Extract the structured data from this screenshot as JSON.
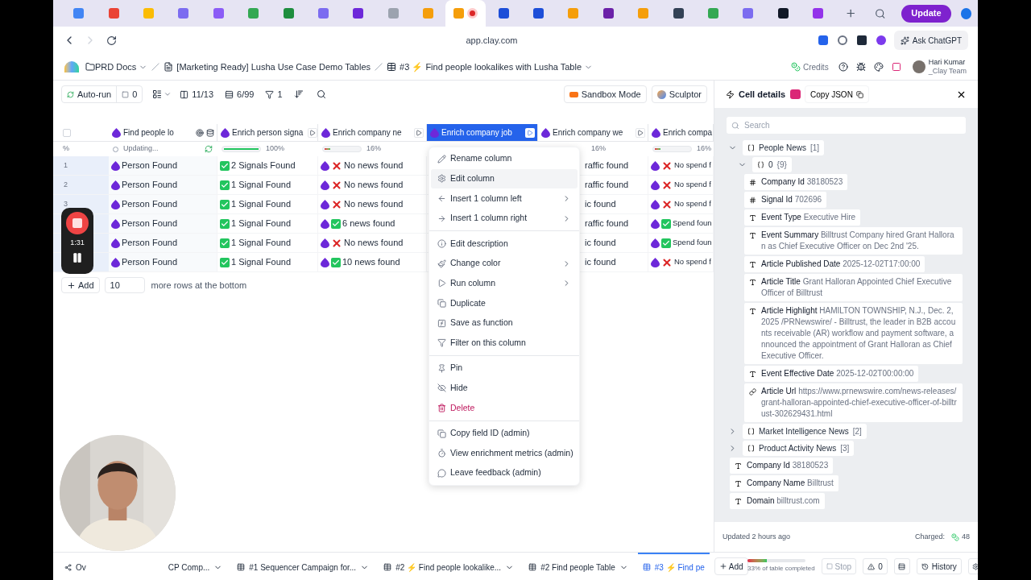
{
  "browser": {
    "tabs": [
      {
        "color": "#4285f4",
        "selected": false
      },
      {
        "color": "#ea4335",
        "selected": false
      },
      {
        "color": "#fbbc04",
        "selected": false
      },
      {
        "color": "#7c6cf0",
        "selected": false
      },
      {
        "color": "#8b5cf6",
        "selected": false
      },
      {
        "color": "#34a853",
        "selected": false
      },
      {
        "color": "#1e8e3e",
        "selected": false
      },
      {
        "color": "#7c6cf0",
        "selected": false
      },
      {
        "color": "#6d28d9",
        "selected": false
      },
      {
        "color": "#9ca3af",
        "selected": false
      },
      {
        "color": "#f59e0b",
        "selected": false
      },
      {
        "color": "#f59e0b",
        "selected": true
      },
      {
        "color": "#1d4ed8",
        "selected": false
      },
      {
        "color": "#1d4ed8",
        "selected": false
      },
      {
        "color": "#f59e0b",
        "selected": false
      },
      {
        "color": "#6b21a8",
        "selected": false
      },
      {
        "color": "#f59e0b",
        "selected": false
      },
      {
        "color": "#334155",
        "selected": false
      },
      {
        "color": "#34a853",
        "selected": false
      },
      {
        "color": "#7c6cf0",
        "selected": false
      },
      {
        "color": "#111827",
        "selected": false
      },
      {
        "color": "#9333ea",
        "selected": false
      }
    ],
    "update_button": "Update",
    "url": "app.clay.com",
    "ask_button": "Ask ChatGPT"
  },
  "breadcrumb": {
    "items": [
      "PRD Docs",
      "[Marketing Ready] Lusha Use Case Demo Tables",
      "#3 ⚡ Find people lookalikes with Lusha Table"
    ],
    "credits": "Credits",
    "user_name": "Hari Kumar",
    "user_team": "_Clay Team"
  },
  "toolbar": {
    "autorun": "Auto-run",
    "selected_count": "0",
    "columns": "11/13",
    "rows": "6/99",
    "filters": "1",
    "sandbox": "Sandbox Mode",
    "sculptor": "Sculptor"
  },
  "table": {
    "select_all_checked": false,
    "percent_label": "%",
    "row_numbers": [
      "1",
      "2",
      "3"
    ],
    "columns": [
      {
        "header": "Find people lo",
        "selected": false,
        "kind": "config",
        "progress": {
          "kind": "updating",
          "text": "Updating..."
        },
        "cells": [
          {
            "text": "Person Found"
          },
          {
            "text": "Person Found"
          },
          {
            "text": "Person Found"
          },
          {
            "text": "Person Found"
          },
          {
            "text": "Person Found"
          },
          {
            "text": "Person Found"
          }
        ]
      },
      {
        "header": "Enrich person signa",
        "selected": false,
        "kind": "run",
        "progress": {
          "kind": "bar",
          "level": 1,
          "reading": "100%"
        },
        "cells": [
          {
            "kind": "found",
            "text": "2 Signals Found"
          },
          {
            "kind": "found",
            "text": "1 Signal Found"
          },
          {
            "kind": "found",
            "text": "1 Signal Found"
          },
          {
            "kind": "found",
            "text": "1 Signal Found"
          },
          {
            "kind": "found",
            "text": "1 Signal Found"
          },
          {
            "kind": "found",
            "text": "1 Signal Found"
          }
        ]
      },
      {
        "header": "Enrich company ne",
        "selected": false,
        "kind": "run",
        "progress": {
          "kind": "bar",
          "level": 0.16,
          "reading": "16%"
        },
        "cells": [
          {
            "kind": "missing",
            "text": "No news found"
          },
          {
            "kind": "missing",
            "text": "No news found"
          },
          {
            "kind": "missing",
            "text": "No news found"
          },
          {
            "kind": "found",
            "text": "6 news found"
          },
          {
            "kind": "missing",
            "text": "No news found"
          },
          {
            "kind": "found",
            "text": "10 news found"
          }
        ]
      },
      {
        "header": "Enrich company job",
        "selected": true,
        "kind": "run"
      },
      {
        "header": "Enrich company we",
        "selected": false,
        "kind": "run",
        "partly_covered": true,
        "progress": {
          "kind": "reading",
          "reading": "16%"
        },
        "cells": [
          {
            "text": "raffic found"
          },
          {
            "text": "raffic found"
          },
          {
            "text": "ic found"
          },
          {
            "text": "raffic found"
          },
          {
            "text": "ic found"
          },
          {
            "text": "ic found"
          }
        ]
      },
      {
        "header": "Enrich compa",
        "selected": false,
        "kind": "plain",
        "progress": {
          "kind": "bar",
          "level": 0.16,
          "reading": "16%"
        },
        "cells": [
          {
            "kind": "missing",
            "text": "No spend f"
          },
          {
            "kind": "missing",
            "text": "No spend f"
          },
          {
            "kind": "missing",
            "text": "No spend f"
          },
          {
            "kind": "found",
            "text": "Spend foun"
          },
          {
            "kind": "found",
            "text": "Spend foun"
          },
          {
            "kind": "missing",
            "text": "No spend f"
          }
        ]
      }
    ]
  },
  "add_rows": {
    "button": "Add",
    "count": "10",
    "suffix": "more rows at the bottom"
  },
  "context_menu": {
    "items": [
      {
        "kind": "item",
        "label": "Rename column",
        "hovered": false
      },
      {
        "kind": "item",
        "label": "Edit column",
        "hovered": true
      },
      {
        "kind": "item",
        "label": "Insert 1 column left",
        "hovered": false,
        "submenu": true
      },
      {
        "kind": "item",
        "label": "Insert 1 column right",
        "hovered": false,
        "submenu": true
      },
      {
        "kind": "separator"
      },
      {
        "kind": "item",
        "label": "Edit description",
        "hovered": false
      },
      {
        "kind": "item",
        "label": "Change color",
        "hovered": false,
        "submenu": true
      },
      {
        "kind": "item",
        "label": "Run column",
        "hovered": false,
        "submenu": true
      },
      {
        "kind": "item",
        "label": "Duplicate",
        "hovered": false
      },
      {
        "kind": "item",
        "label": "Save as function",
        "hovered": false
      },
      {
        "kind": "item",
        "label": "Filter on this column",
        "hovered": false
      },
      {
        "kind": "separator"
      },
      {
        "kind": "item",
        "label": "Pin",
        "hovered": false
      },
      {
        "kind": "item",
        "label": "Hide",
        "hovered": false
      },
      {
        "kind": "danger",
        "label": "Delete",
        "hovered": false
      },
      {
        "kind": "separator"
      },
      {
        "kind": "item",
        "label": "Copy field ID (admin)",
        "hovered": false
      },
      {
        "kind": "item",
        "label": "View enrichment metrics (admin)",
        "hovered": false
      },
      {
        "kind": "item",
        "label": "Leave feedback (admin)",
        "hovered": false
      }
    ]
  },
  "recording": {
    "time": "1:31"
  },
  "cell_details": {
    "title": "Cell details",
    "copy_button": "Copy JSON",
    "search_placeholder": "Search",
    "tree": [
      {
        "kind": "array",
        "key": "People News",
        "count": "[1]",
        "expanded": true,
        "children": [
          {
            "kind": "object",
            "key": "0",
            "count": "{9}",
            "expanded": true,
            "children": [
              {
                "kind": "number",
                "key": "Company Id",
                "value": "38180523"
              },
              {
                "kind": "number",
                "key": "Signal Id",
                "value": "702696"
              },
              {
                "kind": "text",
                "key": "Event Type",
                "value": "Executive Hire"
              },
              {
                "kind": "text",
                "key": "Event Summary",
                "value": "Billtrust Company hired Grant Halloran as Chief Executive Officer on Dec 2nd '25."
              },
              {
                "kind": "text",
                "key": "Article Published Date",
                "value": "2025-12-02T17:00:00"
              },
              {
                "kind": "text",
                "key": "Article Title",
                "value": "Grant Halloran Appointed Chief Executive Officer of Billtrust"
              },
              {
                "kind": "text",
                "key": "Article Highlight",
                "value": "HAMILTON TOWNSHIP, N.J., Dec. 2, 2025 /PRNewswire/ - Billtrust, the leader in B2B accounts receivable (AR) workflow and payment software, announced the appointment of Grant Halloran as Chief Executive Officer."
              },
              {
                "kind": "text",
                "key": "Event Effective Date",
                "value": "2025-12-02T00:00:00"
              },
              {
                "kind": "link",
                "key": "Article Url",
                "value": "https://www.prnewswire.com/news-releases/grant-halloran-appointed-chief-executive-officer-of-billtrust-302629431.html"
              }
            ]
          }
        ]
      },
      {
        "kind": "array",
        "key": "Market Intelligence News",
        "count": "[2]",
        "expanded": false
      },
      {
        "kind": "array",
        "key": "Product Activity News",
        "count": "[3]",
        "expanded": false
      },
      {
        "kind": "text",
        "key": "Company Id",
        "value": "38180523"
      },
      {
        "kind": "text",
        "key": "Company Name",
        "value": "Billtrust"
      },
      {
        "kind": "text",
        "key": "Domain",
        "value": "billtrust.com"
      }
    ],
    "updated": "Updated 2 hours ago",
    "charged_label": "Charged:",
    "charged_value": "48"
  },
  "bottom_tabs": [
    {
      "label": "Ov",
      "selected": false,
      "caret": false
    },
    {
      "label": "CP Comp...",
      "selected": false,
      "caret": true
    },
    {
      "label": "#1 Sequencer Campaign for...",
      "selected": false,
      "caret": true
    },
    {
      "label": "#2 ⚡ Find people lookalike...",
      "selected": false,
      "caret": true
    },
    {
      "label": "#2 Find people Table",
      "selected": false,
      "caret": true
    },
    {
      "label": "#3 ⚡ Find pe",
      "selected": true,
      "caret": false
    }
  ],
  "add_tab": "Add",
  "table_status": {
    "level": 0.33,
    "text": "33% of table completed",
    "stop": "Stop",
    "warnings": "0",
    "history": "History"
  }
}
